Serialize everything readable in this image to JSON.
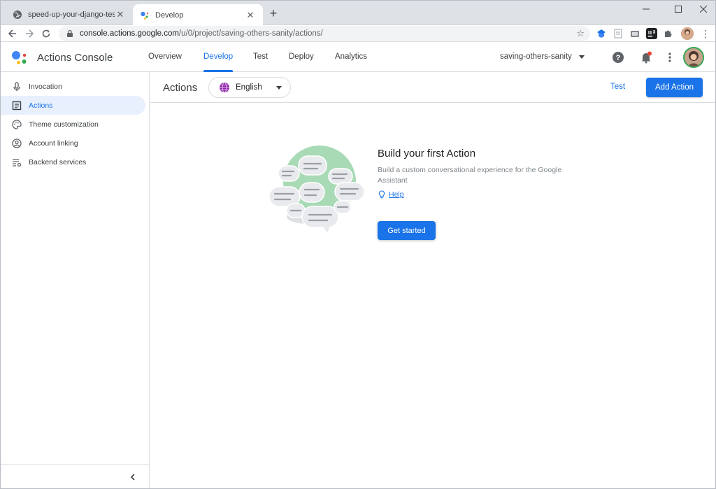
{
  "browser": {
    "tabs": [
      {
        "title": "speed-up-your-django-tests.pdf",
        "favicon": "globe-icon",
        "active": false
      },
      {
        "title": "Develop",
        "favicon": "google-assistant-icon",
        "active": true
      }
    ],
    "new_tab_symbol": "+",
    "url_host": "console.actions.google.com",
    "url_path": "/u/0/project/saving-others-sanity/actions/",
    "window_controls": [
      "minimize-icon",
      "maximize-icon",
      "close-icon"
    ]
  },
  "header": {
    "app_name": "Actions Console",
    "nav": [
      {
        "label": "Overview",
        "active": false
      },
      {
        "label": "Develop",
        "active": true
      },
      {
        "label": "Test",
        "active": false
      },
      {
        "label": "Deploy",
        "active": false
      },
      {
        "label": "Analytics",
        "active": false
      }
    ],
    "project": "saving-others-sanity",
    "icons": [
      "help-icon",
      "notifications-icon",
      "more-vert-icon"
    ]
  },
  "sidebar": {
    "items": [
      {
        "label": "Invocation",
        "icon": "mic-icon",
        "active": false
      },
      {
        "label": "Actions",
        "icon": "list-icon",
        "active": true
      },
      {
        "label": "Theme customization",
        "icon": "palette-icon",
        "active": false
      },
      {
        "label": "Account linking",
        "icon": "account-circle-icon",
        "active": false
      },
      {
        "label": "Backend services",
        "icon": "backend-settings-icon",
        "active": false
      }
    ],
    "collapse_icon": "chevron-left-icon"
  },
  "main": {
    "title": "Actions",
    "language": "English",
    "test_label": "Test",
    "add_action_label": "Add Action",
    "empty_state": {
      "title": "Build your first Action",
      "description": "Build a custom conversational experience for the Google Assistant",
      "help_label": "Help",
      "cta_label": "Get started"
    }
  },
  "colors": {
    "primary": "#1a73e8",
    "active_bg": "#e8f0fe",
    "illustration_green": "#a8dab5",
    "google_blue": "#4285f4",
    "google_red": "#ea4335",
    "google_yellow": "#fbbc04",
    "google_green": "#34a853"
  }
}
